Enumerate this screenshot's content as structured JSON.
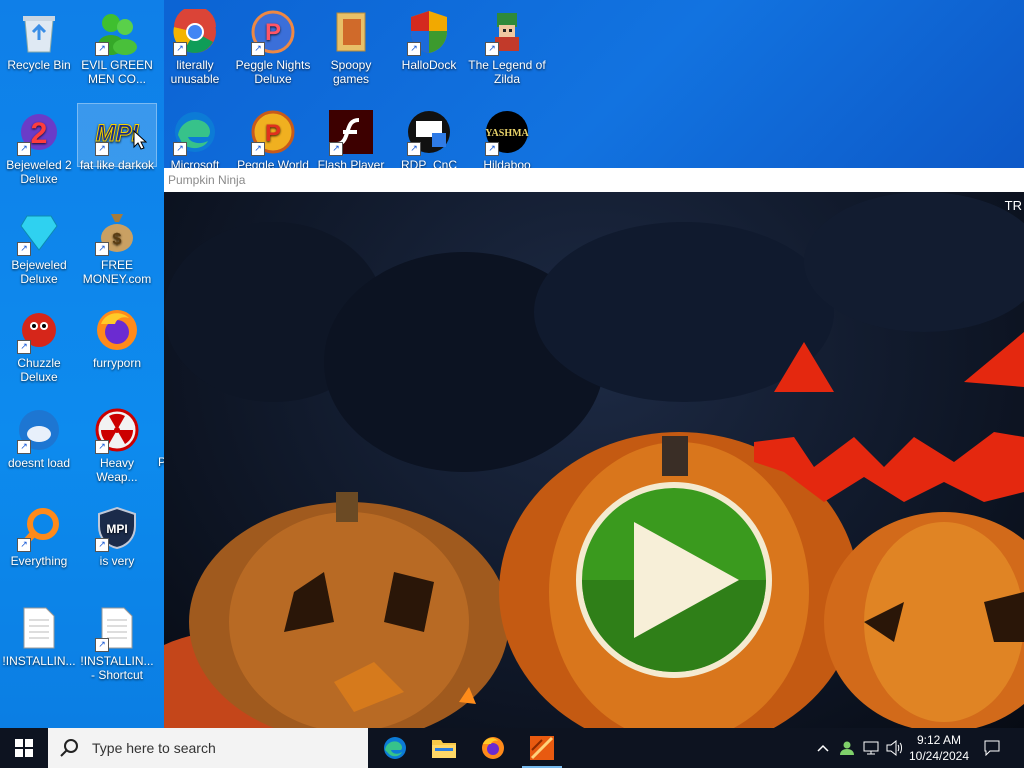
{
  "desktop": {
    "icons": [
      {
        "label": "Recycle Bin"
      },
      {
        "label": "EVIL GREEN MEN CO..."
      },
      {
        "label": "literally unusable"
      },
      {
        "label": "Peggle Nights Deluxe"
      },
      {
        "label": "Spoopy games"
      },
      {
        "label": "HalloDock"
      },
      {
        "label": "The Legend of Zilda"
      },
      {
        "label": "Bejeweled 2 Deluxe"
      },
      {
        "label": "fat like darkok"
      },
      {
        "label": "Microsoft"
      },
      {
        "label": "Peggle World"
      },
      {
        "label": "Flash Player"
      },
      {
        "label": "RDP_CnC"
      },
      {
        "label": "Hildaboo"
      },
      {
        "label": "Bejeweled Deluxe"
      },
      {
        "label": "FREE MONEY.com"
      },
      {
        "label": "Chuzzle Deluxe"
      },
      {
        "label": "furryporn"
      },
      {
        "label": "doesnt load"
      },
      {
        "label": "Heavy Weap..."
      },
      {
        "label": "Everything"
      },
      {
        "label": "is very"
      },
      {
        "label": "!INSTALLIN..."
      },
      {
        "label": "!INSTALLIN... - Shortcut"
      }
    ],
    "partial_label": "P"
  },
  "game_window": {
    "title": "Pumpkin Ninja",
    "corner_text": "TR"
  },
  "taskbar": {
    "search_placeholder": "Type here to search",
    "time": "9:12 AM",
    "date": "10/24/2024"
  },
  "colors": {
    "accent": "#76b9ed",
    "play_green": "#3a9a1e",
    "pumpkin_orange": "#d9761c",
    "jack_red": "#e4280f"
  }
}
